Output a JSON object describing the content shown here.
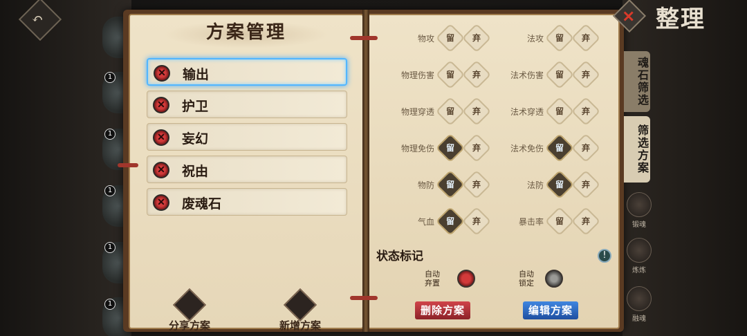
{
  "header": {
    "title": "整理",
    "close_label": "✕"
  },
  "left_strip": {
    "back_icon": "back-icon",
    "badges": [
      "1",
      "1",
      "1",
      "1",
      "1",
      "1"
    ]
  },
  "plans_page": {
    "title": "方案管理",
    "plans": [
      {
        "label": "输出",
        "active": true
      },
      {
        "label": "护卫",
        "active": false
      },
      {
        "label": "妄幻",
        "active": false
      },
      {
        "label": "祝由",
        "active": false
      },
      {
        "label": "废魂石",
        "active": false
      }
    ],
    "share_label": "分享方案",
    "new_label": "新增方案"
  },
  "filter_page": {
    "keep_label": "留",
    "drop_label": "弃",
    "left_col": [
      {
        "name": "物攻",
        "keep_on": false
      },
      {
        "name": "物理伤害",
        "keep_on": false
      },
      {
        "name": "物理穿透",
        "keep_on": false
      },
      {
        "name": "物理免伤",
        "keep_on": true
      },
      {
        "name": "物防",
        "keep_on": true
      },
      {
        "name": "气血",
        "keep_on": true
      }
    ],
    "right_col": [
      {
        "name": "法攻",
        "keep_on": false
      },
      {
        "name": "法术伤害",
        "keep_on": false
      },
      {
        "name": "法术穿透",
        "keep_on": false
      },
      {
        "name": "法术免伤",
        "keep_on": true
      },
      {
        "name": "法防",
        "keep_on": true
      },
      {
        "name": "暴击率",
        "keep_on": false
      }
    ],
    "status_title": "状态标记",
    "info_label": "!",
    "auto_discard": "自动弃置",
    "auto_lock": "自动锁定",
    "delete_label": "删除方案",
    "edit_label": "编辑方案"
  },
  "side_tabs": {
    "tab1": "魂石筛选",
    "tab2": "筛选方案",
    "icons": [
      "锻魂",
      "炼炼",
      "融魂"
    ]
  },
  "colors": {
    "accent_blue": "#4ab0ff",
    "delete_red": "#b8343a",
    "edit_blue": "#2f6fc8"
  }
}
